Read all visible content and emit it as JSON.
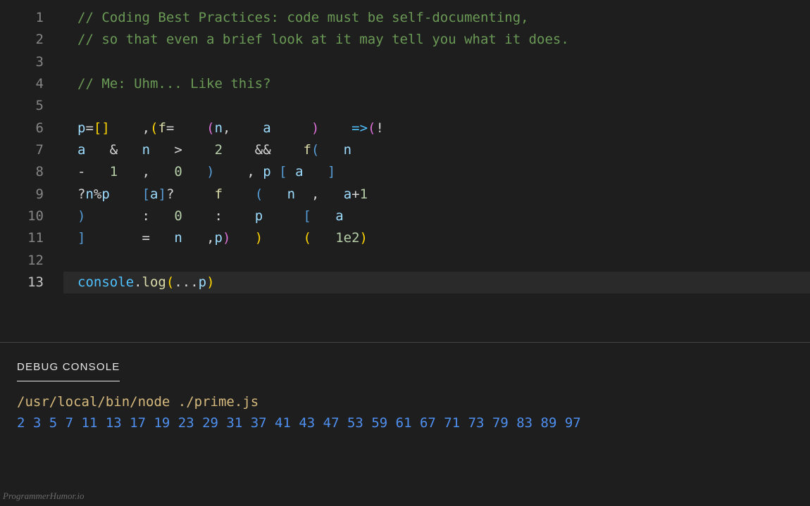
{
  "editor": {
    "lines": [
      {
        "n": 1,
        "tokens": [
          {
            "t": "// Coding Best Practices: code must be self-documenting,",
            "c": "tok-comment"
          }
        ]
      },
      {
        "n": 2,
        "tokens": [
          {
            "t": "// so that even a brief look at it may tell you what it does.",
            "c": "tok-comment"
          }
        ]
      },
      {
        "n": 3,
        "tokens": [
          {
            "t": "",
            "c": "tok-punct"
          }
        ]
      },
      {
        "n": 4,
        "tokens": [
          {
            "t": "// Me: Uhm... Like this?",
            "c": "tok-comment"
          }
        ]
      },
      {
        "n": 5,
        "tokens": [
          {
            "t": "",
            "c": "tok-punct"
          }
        ]
      },
      {
        "n": 6,
        "tokens": [
          {
            "t": "p",
            "c": "tok-var"
          },
          {
            "t": "=",
            "c": "tok-op"
          },
          {
            "t": "[]",
            "c": "tok-brace"
          },
          {
            "t": "    ",
            "c": ""
          },
          {
            "t": ",",
            "c": "tok-punct"
          },
          {
            "t": "(",
            "c": "tok-brace"
          },
          {
            "t": "f",
            "c": "tok-func"
          },
          {
            "t": "=",
            "c": "tok-op"
          },
          {
            "t": "    ",
            "c": ""
          },
          {
            "t": "(",
            "c": "tok-brace2"
          },
          {
            "t": "n",
            "c": "tok-var"
          },
          {
            "t": ",",
            "c": "tok-punct"
          },
          {
            "t": "    ",
            "c": ""
          },
          {
            "t": "a",
            "c": "tok-var"
          },
          {
            "t": "     ",
            "c": ""
          },
          {
            "t": ")",
            "c": "tok-brace2"
          },
          {
            "t": "    ",
            "c": ""
          },
          {
            "t": "=>",
            "c": "tok-key"
          },
          {
            "t": "(",
            "c": "tok-brace2"
          },
          {
            "t": "!",
            "c": "tok-op"
          }
        ]
      },
      {
        "n": 7,
        "tokens": [
          {
            "t": "a",
            "c": "tok-var"
          },
          {
            "t": "   ",
            "c": ""
          },
          {
            "t": "&",
            "c": "tok-op"
          },
          {
            "t": "   ",
            "c": ""
          },
          {
            "t": "n",
            "c": "tok-var"
          },
          {
            "t": "   ",
            "c": ""
          },
          {
            "t": ">",
            "c": "tok-op"
          },
          {
            "t": "    ",
            "c": ""
          },
          {
            "t": "2",
            "c": "tok-num"
          },
          {
            "t": "    ",
            "c": ""
          },
          {
            "t": "&&",
            "c": "tok-op"
          },
          {
            "t": "    ",
            "c": ""
          },
          {
            "t": "f",
            "c": "tok-func"
          },
          {
            "t": "(",
            "c": "tok-brace3"
          },
          {
            "t": "   ",
            "c": ""
          },
          {
            "t": "n",
            "c": "tok-var"
          }
        ]
      },
      {
        "n": 8,
        "tokens": [
          {
            "t": "-",
            "c": "tok-op"
          },
          {
            "t": "   ",
            "c": ""
          },
          {
            "t": "1",
            "c": "tok-num"
          },
          {
            "t": "   ",
            "c": ""
          },
          {
            "t": ",",
            "c": "tok-punct"
          },
          {
            "t": "   ",
            "c": ""
          },
          {
            "t": "0",
            "c": "tok-num"
          },
          {
            "t": "   ",
            "c": ""
          },
          {
            "t": ")",
            "c": "tok-brace3"
          },
          {
            "t": "    ",
            "c": ""
          },
          {
            "t": ",",
            "c": "tok-punct"
          },
          {
            "t": " ",
            "c": ""
          },
          {
            "t": "p",
            "c": "tok-var"
          },
          {
            "t": " ",
            "c": ""
          },
          {
            "t": "[",
            "c": "tok-brace3"
          },
          {
            "t": " ",
            "c": ""
          },
          {
            "t": "a",
            "c": "tok-var"
          },
          {
            "t": "   ",
            "c": ""
          },
          {
            "t": "]",
            "c": "tok-brace3"
          }
        ]
      },
      {
        "n": 9,
        "tokens": [
          {
            "t": "?",
            "c": "tok-op"
          },
          {
            "t": "n",
            "c": "tok-var"
          },
          {
            "t": "%",
            "c": "tok-op"
          },
          {
            "t": "p",
            "c": "tok-var"
          },
          {
            "t": "    ",
            "c": ""
          },
          {
            "t": "[",
            "c": "tok-brace3"
          },
          {
            "t": "a",
            "c": "tok-var"
          },
          {
            "t": "]",
            "c": "tok-brace3"
          },
          {
            "t": "?",
            "c": "tok-op"
          },
          {
            "t": "     ",
            "c": ""
          },
          {
            "t": "f",
            "c": "tok-func"
          },
          {
            "t": "    ",
            "c": ""
          },
          {
            "t": "(",
            "c": "tok-brace3"
          },
          {
            "t": "   ",
            "c": ""
          },
          {
            "t": "n",
            "c": "tok-var"
          },
          {
            "t": "  ",
            "c": ""
          },
          {
            "t": ",",
            "c": "tok-punct"
          },
          {
            "t": "   ",
            "c": ""
          },
          {
            "t": "a",
            "c": "tok-var"
          },
          {
            "t": "+",
            "c": "tok-op"
          },
          {
            "t": "1",
            "c": "tok-num"
          }
        ]
      },
      {
        "n": 10,
        "tokens": [
          {
            "t": ")",
            "c": "tok-brace3"
          },
          {
            "t": "       ",
            "c": ""
          },
          {
            "t": ":",
            "c": "tok-op"
          },
          {
            "t": "   ",
            "c": ""
          },
          {
            "t": "0",
            "c": "tok-num"
          },
          {
            "t": "    ",
            "c": ""
          },
          {
            "t": ":",
            "c": "tok-op"
          },
          {
            "t": "    ",
            "c": ""
          },
          {
            "t": "p",
            "c": "tok-var"
          },
          {
            "t": "     ",
            "c": ""
          },
          {
            "t": "[",
            "c": "tok-brace3"
          },
          {
            "t": "   ",
            "c": ""
          },
          {
            "t": "a",
            "c": "tok-var"
          }
        ]
      },
      {
        "n": 11,
        "tokens": [
          {
            "t": "]",
            "c": "tok-brace3"
          },
          {
            "t": "       ",
            "c": ""
          },
          {
            "t": "=",
            "c": "tok-op"
          },
          {
            "t": "   ",
            "c": ""
          },
          {
            "t": "n",
            "c": "tok-var"
          },
          {
            "t": "   ",
            "c": ""
          },
          {
            "t": ",",
            "c": "tok-punct"
          },
          {
            "t": "p",
            "c": "tok-var"
          },
          {
            "t": ")",
            "c": "tok-brace2"
          },
          {
            "t": "   ",
            "c": ""
          },
          {
            "t": ")",
            "c": "tok-brace"
          },
          {
            "t": "     ",
            "c": ""
          },
          {
            "t": "(",
            "c": "tok-brace"
          },
          {
            "t": "   ",
            "c": ""
          },
          {
            "t": "1e2",
            "c": "tok-num"
          },
          {
            "t": ")",
            "c": "tok-brace"
          }
        ]
      },
      {
        "n": 12,
        "tokens": [
          {
            "t": "",
            "c": "tok-punct"
          }
        ]
      },
      {
        "n": 13,
        "active": true,
        "tokens": [
          {
            "t": "console",
            "c": "tok-obj"
          },
          {
            "t": ".",
            "c": "tok-punct"
          },
          {
            "t": "log",
            "c": "tok-func"
          },
          {
            "t": "(",
            "c": "tok-brace"
          },
          {
            "t": "...",
            "c": "tok-op"
          },
          {
            "t": "p",
            "c": "tok-var"
          },
          {
            "t": ")",
            "c": "tok-brace"
          }
        ]
      }
    ]
  },
  "debug": {
    "tab": "DEBUG CONSOLE",
    "command": "/usr/local/bin/node ./prime.js",
    "output": "2 3 5 7 11 13 17 19 23 29 31 37 41 43 47 53 59 61 67 71 73 79 83 89 97"
  },
  "watermark": "ProgrammerHumor.io"
}
